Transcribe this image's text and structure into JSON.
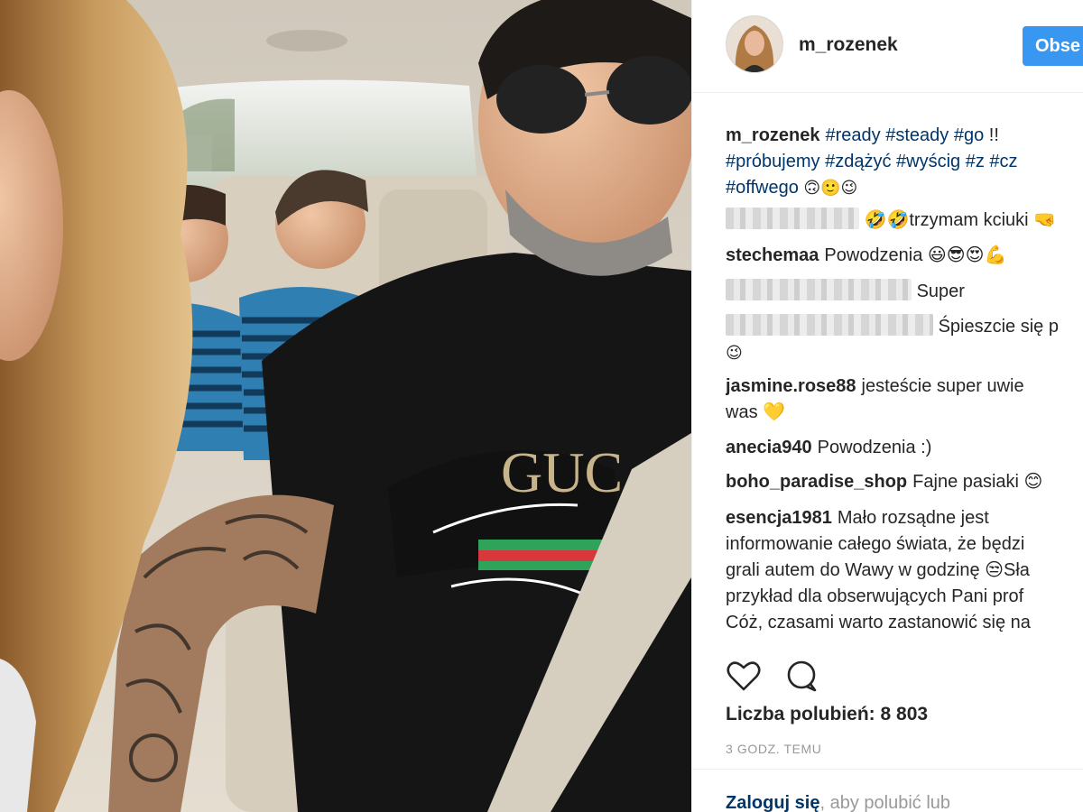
{
  "header": {
    "username": "m_rozenek",
    "follow_label": "Obse"
  },
  "comments": [
    {
      "username": "m_rozenek",
      "segments": [
        {
          "type": "tag",
          "text": "#ready"
        },
        {
          "type": "tag",
          "text": "#steady"
        },
        {
          "type": "tag",
          "text": "#go"
        },
        {
          "type": "text",
          "text": "!!"
        }
      ],
      "line2": [
        "#próbujemy",
        "#zdążyć",
        "#wyścig",
        "#z",
        "#cz"
      ],
      "line3_tag": "#offwego",
      "line3_emoji": "🙃🙂😉"
    },
    {
      "blurred": true,
      "text": "🤣🤣trzymam kciuki 🤜"
    },
    {
      "username": "stechemaa",
      "text": "Powodzenia 😃😎😍💪"
    },
    {
      "blurred": true,
      "text": "Super"
    },
    {
      "blurred": true,
      "text": "Śpieszcie się p",
      "line2": "😉"
    },
    {
      "username": "jasmine.rose88",
      "text": "jesteście super uwie",
      "line2": "was 💛"
    },
    {
      "username": "anecia940",
      "text": "Powodzenia :)"
    },
    {
      "username": "boho_paradise_shop",
      "text": "Fajne pasiaki 😊"
    },
    {
      "username": "esencja1981",
      "text": "Mało rozsądne jest",
      "lines": [
        "informowanie całego świata, że będzi",
        "grali autem do Wawy w godzinę 😒Sła",
        "przykład dla obserwujących Pani prof",
        "Cóż, czasami warto zastanowić się na"
      ]
    }
  ],
  "actions": {
    "like_icon": "heart-outline-icon",
    "comment_icon": "speech-bubble-icon"
  },
  "likes_text": "Liczba polubień: 8 803",
  "timestamp": "3 GODZ. TEMU",
  "footer": {
    "login_link": "Zaloguj się",
    "login_rest": ", aby polubić lub"
  },
  "colors": {
    "accent": "#3897f0",
    "hashtag": "#003569",
    "muted": "#999999"
  }
}
